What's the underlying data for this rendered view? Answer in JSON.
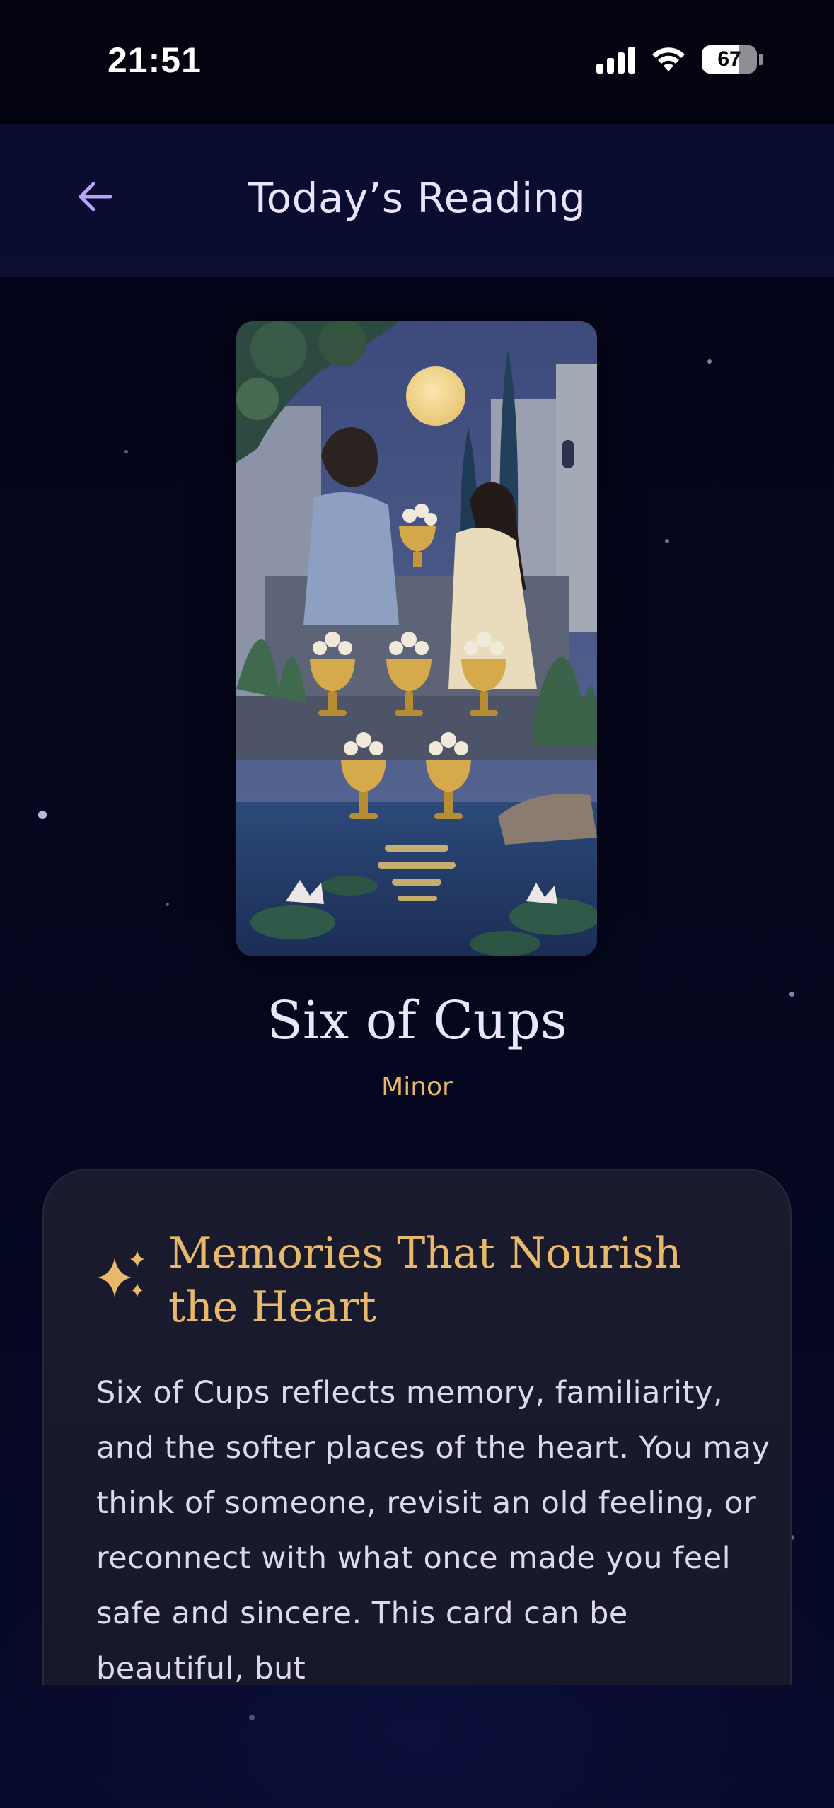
{
  "status_bar": {
    "time": "21:51",
    "battery_level": "67",
    "battery_fraction": 0.67
  },
  "header": {
    "back_icon": "arrow-left-icon",
    "title": "Today’s Reading"
  },
  "card": {
    "name": "Six of Cups",
    "arcana": "Minor"
  },
  "reading": {
    "icon": "sparkles-icon",
    "heading": "Memories That Nourish the Heart",
    "body": "Six of Cups reflects memory, familiarity, and the softer places of the heart. You may think of someone, revisit an old feeling, or reconnect with what once made you feel safe and sincere. This card can be beautiful, but"
  },
  "colors": {
    "accent_gold": "#e7b867",
    "title_text": "#e9e4fb",
    "back_arrow": "#b9a3f5",
    "panel_bg": "#1a1b2e",
    "page_bg": "#04051a"
  }
}
